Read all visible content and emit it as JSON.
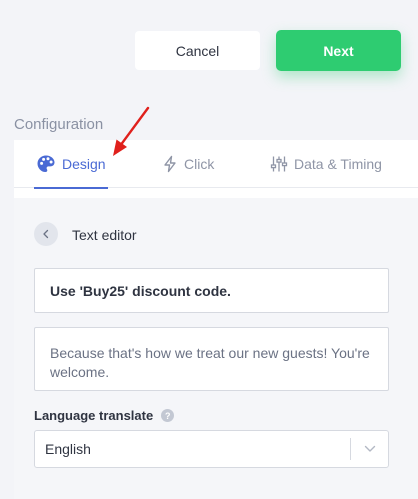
{
  "header": {
    "cancel_label": "Cancel",
    "next_label": "Next"
  },
  "section": {
    "title": "Configuration"
  },
  "tabs": [
    {
      "label": "Design",
      "icon": "palette-icon",
      "active": true
    },
    {
      "label": "Click",
      "icon": "lightning-icon",
      "active": false
    },
    {
      "label": "Data & Timing",
      "icon": "sliders-icon",
      "active": false
    }
  ],
  "editor": {
    "title": "Text editor",
    "headline_value": "Use 'Buy25' discount code.",
    "body_value": "Because that's how we treat our new guests! You're welcome."
  },
  "language": {
    "label": "Language translate",
    "selected": "English"
  },
  "colors": {
    "accent": "#4a6ad4",
    "primary_button": "#2ecc71",
    "annotation_arrow": "#e0201c",
    "background": "#f3f4f8"
  }
}
